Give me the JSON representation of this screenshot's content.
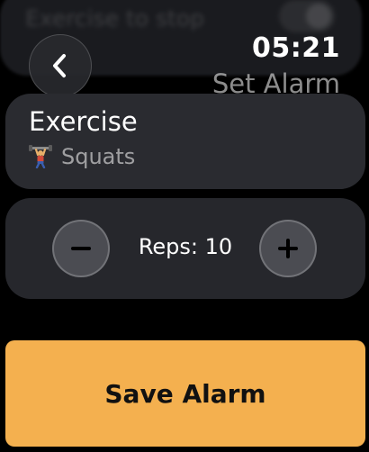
{
  "background_row": {
    "label": "Exercise to stop"
  },
  "header": {
    "back_icon": "chevron-left-icon",
    "time": "05:21",
    "title": "Set Alarm"
  },
  "exercise": {
    "title": "Exercise",
    "icon": "weightlifter-icon",
    "value": "Squats"
  },
  "reps": {
    "label": "Reps: 10",
    "value": 10,
    "decrement_icon": "minus-icon",
    "increment_icon": "plus-icon"
  },
  "save": {
    "label": "Save Alarm"
  },
  "colors": {
    "accent": "#f4b04f",
    "card": "#2a2b30",
    "stepper": "#4b4c52"
  }
}
